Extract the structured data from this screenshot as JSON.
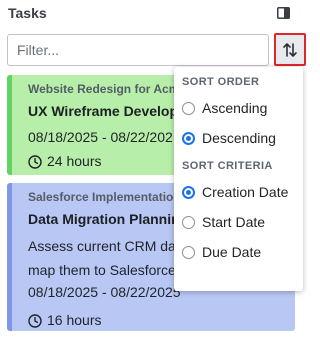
{
  "panel": {
    "title": "Tasks",
    "toggle_icon": "panel-toggle-icon"
  },
  "filter": {
    "placeholder": "Filter...",
    "value": ""
  },
  "sort_button": {
    "icon": "sort-arrows-icon",
    "highlight_color": "#e0262a"
  },
  "tasks": [
    {
      "project": "Website Redesign for Acme",
      "title": "UX Wireframe Developm",
      "description": [],
      "dates": "08/18/2025 - 08/22/202",
      "hours": "24 hours",
      "bg_color": "#b7efaa",
      "accent_color": "#63d463"
    },
    {
      "project": "Salesforce Implementation -",
      "title": "Data Migration Planning",
      "description": [
        "Assess current CRM dat",
        "map them to Salesforce"
      ],
      "dates": "08/18/2025 - 08/22/2025",
      "hours": "16 hours",
      "bg_color": "#b8c7f3",
      "accent_color": "#7f98e6"
    }
  ],
  "sort_menu": {
    "order_heading": "SORT ORDER",
    "order_options": [
      {
        "label": "Ascending",
        "selected": false
      },
      {
        "label": "Descending",
        "selected": true
      }
    ],
    "criteria_heading": "SORT CRITERIA",
    "criteria_options": [
      {
        "label": "Creation Date",
        "selected": true
      },
      {
        "label": "Start Date",
        "selected": false
      },
      {
        "label": "Due Date",
        "selected": false
      }
    ],
    "accent_color": "#1a73e8"
  }
}
